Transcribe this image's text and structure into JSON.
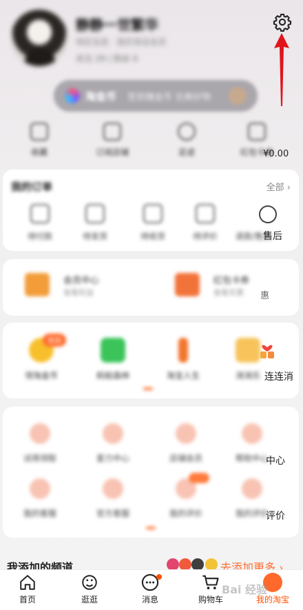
{
  "profile": {
    "nickname": "静静一世繁华",
    "subtitle": "地区信息 · 我的淘宝会员",
    "stats": "关注 28 | 粉丝 6",
    "settings_icon": "gear-icon",
    "annotation": "red-arrow-pointing-to-settings"
  },
  "vip": {
    "title": "淘金币",
    "text": "签到赚金币 兑换好物"
  },
  "quick": {
    "items": [
      {
        "label": "收藏",
        "icon": "star-icon"
      },
      {
        "label": "订阅店铺",
        "icon": "store-icon"
      },
      {
        "label": "足迹",
        "icon": "clock-icon"
      },
      {
        "label": "红包卡券",
        "icon": "coupon-icon"
      }
    ],
    "value": "¥0.00"
  },
  "orders": {
    "title": "我的订单",
    "more": "全部 ›",
    "items": [
      {
        "label": "待付款"
      },
      {
        "label": "待发货"
      },
      {
        "label": "待收货"
      },
      {
        "label": "待评价"
      },
      {
        "label": "退款/售后"
      }
    ],
    "after_sale_label": "售后"
  },
  "member": {
    "tiles": [
      {
        "name": "会员中心",
        "sub": "查看权益"
      },
      {
        "name": "红包卡券",
        "sub": "查看优惠"
      }
    ],
    "edge_text": "惠"
  },
  "apps": {
    "items": [
      {
        "label": "领淘金币",
        "badge": "签到"
      },
      {
        "label": "蚂蚁森林"
      },
      {
        "label": "淘宝人生"
      },
      {
        "label": "消消乐"
      }
    ],
    "edge_label": "连连消"
  },
  "services": {
    "row1": [
      {
        "label": "试用领取"
      },
      {
        "label": "星力中心"
      },
      {
        "label": "店铺会员"
      },
      {
        "label": "帮助中心"
      }
    ],
    "row2": [
      {
        "label": "我的客服"
      },
      {
        "label": "官方客服"
      },
      {
        "label": "我的评价"
      },
      {
        "label": "我的评价"
      }
    ],
    "row1_edge": "中心",
    "row2_edge": "评价"
  },
  "channels": {
    "title": "我添加的频道",
    "more": "去添加更多 ›"
  },
  "tabbar": {
    "items": [
      {
        "label": "首页",
        "icon": "home-icon"
      },
      {
        "label": "逛逛",
        "icon": "stroll-icon"
      },
      {
        "label": "消息",
        "icon": "message-icon"
      },
      {
        "label": "购物车",
        "icon": "cart-icon"
      },
      {
        "label": "我的淘宝",
        "icon": "avatar-icon"
      }
    ]
  },
  "watermark": "Bai 经验",
  "colors": {
    "accent": "#ff5000",
    "arrow": "#e0151b"
  }
}
